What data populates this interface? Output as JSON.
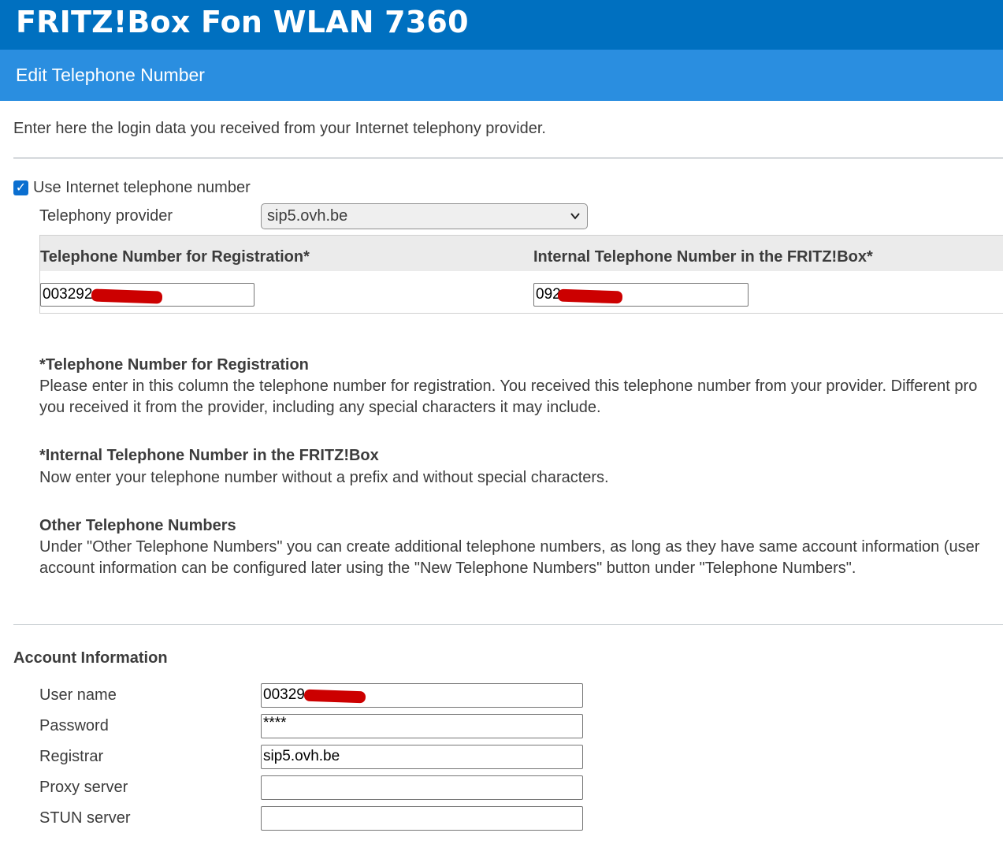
{
  "header": {
    "product_name": "FRITZ!Box Fon WLAN 7360",
    "page_title": "Edit Telephone Number"
  },
  "intro_text": "Enter here the login data you received from your Internet telephony provider.",
  "use_internet_number": {
    "label": "Use Internet telephone number",
    "checked": true
  },
  "provider": {
    "label": "Telephony provider",
    "selected": "sip5.ovh.be"
  },
  "number_table": {
    "col_registration": "Telephone Number for Registration*",
    "col_internal": "Internal Telephone Number in the FRITZ!Box*",
    "registration_value": "003292",
    "internal_value": "092"
  },
  "help": {
    "registration_title": "*Telephone Number for Registration",
    "registration_line1": "Please enter in this column the telephone number for registration. You received this telephone number from your provider. Different pro",
    "registration_line2": "you received it from the provider, including any special characters it may include.",
    "internal_title": "*Internal Telephone Number in the FRITZ!Box",
    "internal_line1": "Now enter your telephone number without a prefix and without special characters.",
    "other_title": "Other Telephone Numbers",
    "other_line1": "Under \"Other Telephone Numbers\" you can create additional telephone numbers, as long as they have same account information (user",
    "other_line2": "account information can be configured later using the \"New Telephone Numbers\" button under \"Telephone Numbers\"."
  },
  "account": {
    "section_title": "Account Information",
    "username_label": "User name",
    "username_value": "00329",
    "password_label": "Password",
    "password_value": "****",
    "registrar_label": "Registrar",
    "registrar_value": "sip5.ovh.be",
    "proxy_label": "Proxy server",
    "proxy_value": "",
    "stun_label": "STUN server",
    "stun_value": ""
  },
  "colors": {
    "topbar": "#0070c0",
    "subbar": "#2a8ee0",
    "redaction": "#cc0000"
  },
  "icons": {
    "checkbox": "checkmark-icon",
    "select": "chevron-down-icon"
  }
}
